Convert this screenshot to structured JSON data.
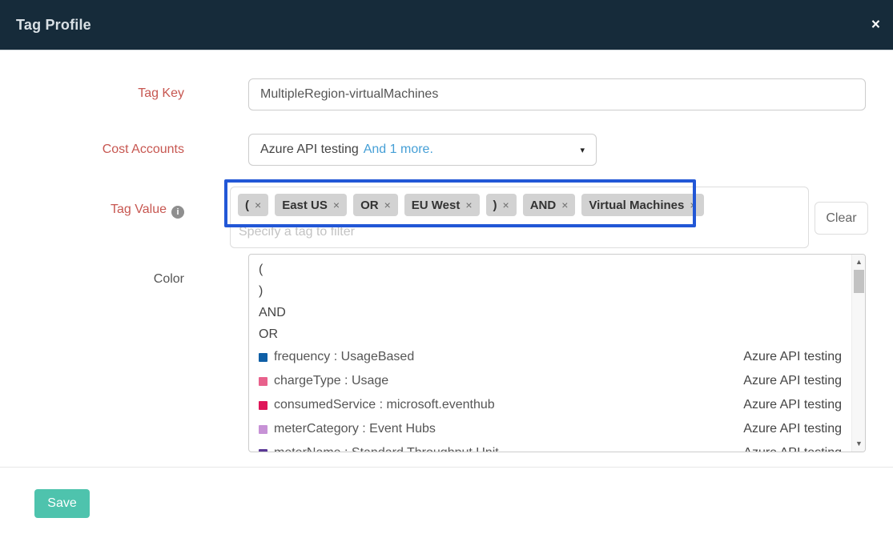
{
  "modal": {
    "title": "Tag Profile",
    "close_icon": "×"
  },
  "form": {
    "tag_key": {
      "label": "Tag Key",
      "value": "MultipleRegion-virtualMachines"
    },
    "cost_accounts": {
      "label": "Cost Accounts",
      "selected": "Azure API testing",
      "more_link": "And 1 more.",
      "caret_icon": "▾"
    },
    "tag_value": {
      "label": "Tag Value",
      "info_icon": "i",
      "chips": [
        "(",
        "East US",
        "OR",
        "EU West",
        ")",
        "AND",
        "Virtual Machines"
      ],
      "chip_remove_icon": "×",
      "placeholder": "Specify a tag to filter",
      "clear_button": "Clear",
      "highlight_color": "#2257d6"
    },
    "color": {
      "label": "Color",
      "plain_options": [
        "(",
        ")",
        "AND",
        "OR"
      ],
      "tag_options": [
        {
          "name": "frequency : UsageBased",
          "account": "Azure API testing",
          "swatch": "#0f5fa6"
        },
        {
          "name": "chargeType : Usage",
          "account": "Azure API testing",
          "swatch": "#e8618c"
        },
        {
          "name": "consumedService : microsoft.eventhub",
          "account": "Azure API testing",
          "swatch": "#df1659"
        },
        {
          "name": "meterCategory : Event Hubs",
          "account": "Azure API testing",
          "swatch": "#c792d6"
        },
        {
          "name": "meterName : Standard Throughput Unit",
          "account": "Azure API testing",
          "swatch": "#5a3896"
        }
      ],
      "scroll_up_icon": "▲",
      "scroll_down_icon": "▼"
    }
  },
  "footer": {
    "save_button": "Save"
  },
  "colors": {
    "header_bg": "#162b3a",
    "label_red": "#c75751",
    "link_blue": "#459fd6",
    "save_teal": "#4ec3ad"
  }
}
